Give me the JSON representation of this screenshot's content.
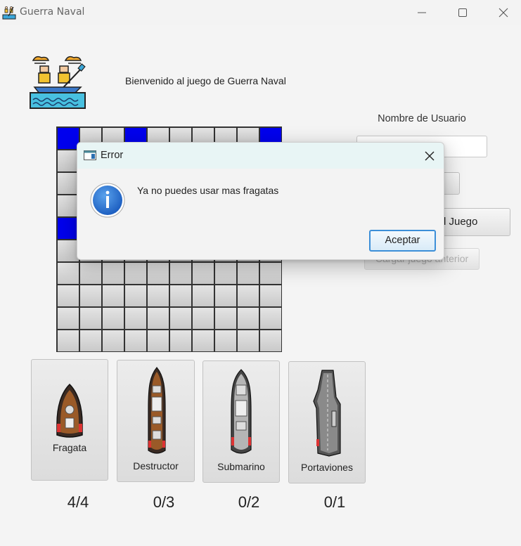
{
  "window": {
    "title": "Guerra Naval",
    "icon": "boat-rowers-icon"
  },
  "welcome": "Bienvenido al juego de Guerra Naval",
  "user": {
    "label": "Nombre de Usuario",
    "value": "",
    "placeholder": ""
  },
  "buttons": {
    "hidden_partial": "o",
    "new_game_partial": "l Juego",
    "load_previous_partial": "Cargar juego anterior"
  },
  "board": {
    "rows": 10,
    "cols": 10,
    "ship_cells": [
      [
        0,
        0
      ],
      [
        0,
        3
      ],
      [
        0,
        9
      ],
      [
        4,
        0
      ]
    ],
    "cell_color": "#d6d6d6",
    "ship_color": "#0000ee"
  },
  "ships": [
    {
      "name": "Fragata",
      "count": "4/4",
      "icon": "frigate-icon"
    },
    {
      "name": "Destructor",
      "count": "0/3",
      "icon": "destroyer-icon"
    },
    {
      "name": "Submarino",
      "count": "0/2",
      "icon": "submarine-icon"
    },
    {
      "name": "Portaviones",
      "count": "0/1",
      "icon": "aircraft-carrier-icon"
    }
  ],
  "dialog": {
    "title": "Error",
    "message": "Ya no puedes usar mas fragatas",
    "ok_label": "Aceptar",
    "icon": "info-icon",
    "accent": "#3c8fd8"
  }
}
